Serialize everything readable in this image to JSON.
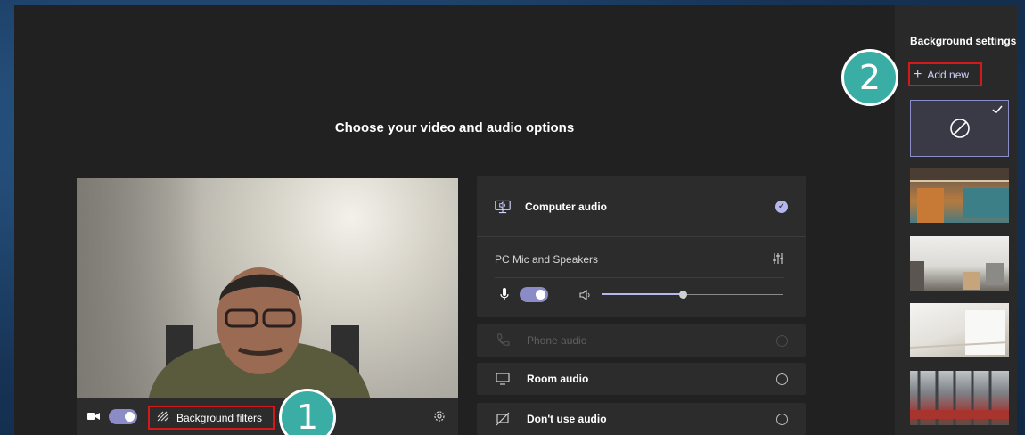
{
  "main": {
    "title": "Choose your video and audio options"
  },
  "video_controls": {
    "camera_toggle_on": true,
    "background_filters_label": "Background filters"
  },
  "audio": {
    "computer_audio": {
      "label": "Computer audio",
      "selected": true
    },
    "device": {
      "label": "PC Mic and Speakers"
    },
    "mic_toggle_on": true,
    "volume_level": 0.45,
    "options": [
      {
        "label": "Phone audio",
        "disabled": true
      },
      {
        "label": "Room audio",
        "disabled": false
      },
      {
        "label": "Don't use audio",
        "disabled": false
      }
    ]
  },
  "sidebar": {
    "title": "Background settings",
    "add_new_label": "Add new"
  },
  "badges": {
    "step1": "1",
    "step2": "2"
  },
  "colors": {
    "accent": "#8b8cc7",
    "highlight_border": "#d31a1a",
    "badge": "#3aaea4",
    "panel": "#2d2c2c",
    "background": "#212121"
  }
}
